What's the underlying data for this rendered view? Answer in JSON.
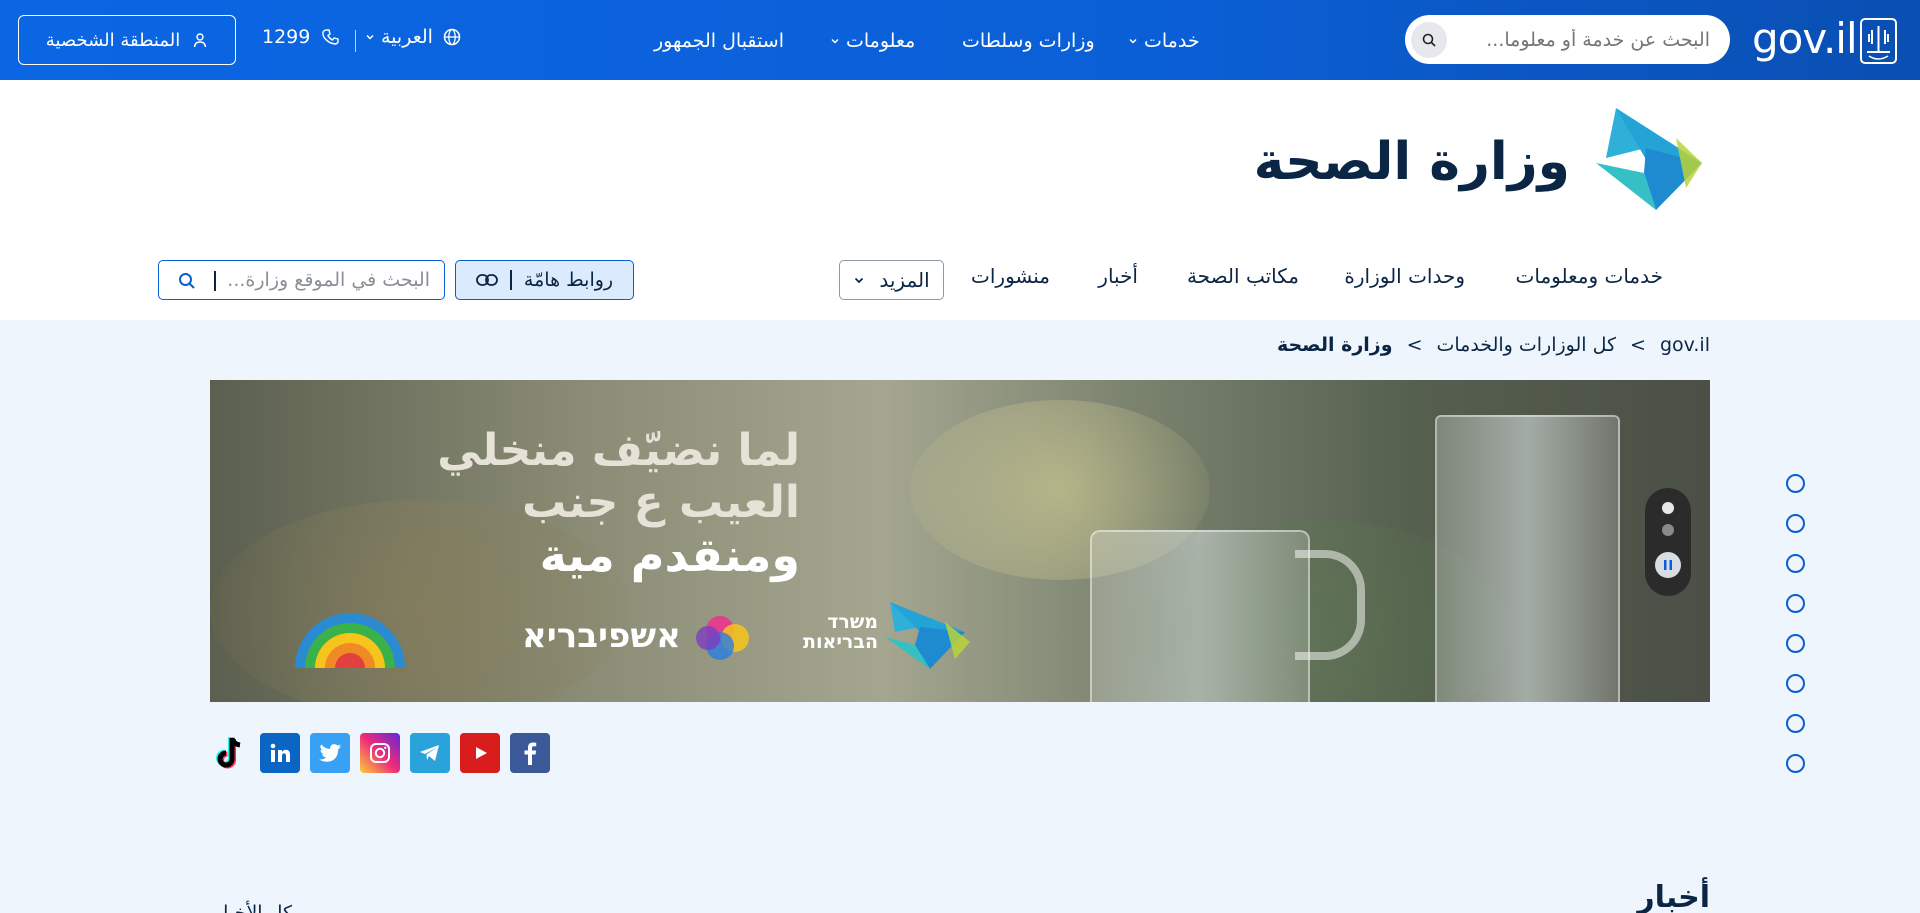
{
  "topbar": {
    "logo_text": "gov.il",
    "search_placeholder": "البحث عن خدمة أو معلوما...",
    "nav": [
      {
        "label": "خدمات"
      },
      {
        "label": "وزارات وسلطات"
      },
      {
        "label": "معلومات"
      },
      {
        "label": "استقبال الجمهور"
      }
    ],
    "language": "العربية",
    "phone": "1299",
    "personal_area": "المنطقة الشخصية"
  },
  "ministry": {
    "title": "وزارة الصحة",
    "nav": [
      {
        "label": "خدمات ومعلومات"
      },
      {
        "label": "وحدات الوزارة"
      },
      {
        "label": "مكاتب الصحة"
      },
      {
        "label": "أخبار"
      },
      {
        "label": "منشورات"
      }
    ],
    "more_label": "المزيد",
    "links_label": "روابط هامّة",
    "search_placeholder": "البحث في الموقع وزارة..."
  },
  "breadcrumb": {
    "items": [
      "gov.il",
      "كل الوزارات والخدمات"
    ],
    "current": "وزارة الصحة",
    "separator": ">"
  },
  "banner": {
    "line1": "لما نضيّف منخلي",
    "line2": "العيب ع جنب",
    "line3": "ومنقدم مية",
    "moh_logo_text": "משרד הבריאות",
    "partner_text": "אשפיבריא",
    "slides_total": 2,
    "active_slide": 1
  },
  "side_nav": {
    "count": 8
  },
  "social": [
    {
      "name": "facebook",
      "color": "#3b5998"
    },
    {
      "name": "youtube",
      "color": "#d91c1c"
    },
    {
      "name": "telegram",
      "color": "#2aa3dc"
    },
    {
      "name": "instagram",
      "color": "#d6249f"
    },
    {
      "name": "twitter",
      "color": "#38a1f3"
    },
    {
      "name": "linkedin",
      "color": "#0a66c2"
    },
    {
      "name": "tiktok",
      "color": "#000000"
    }
  ],
  "news": {
    "title": "أخبار",
    "all_link": "كل الأخبار"
  },
  "colors": {
    "topbar": "#0b66e4",
    "accent": "#0a5ed4",
    "page_bg": "#eef5fd",
    "text": "#0b2644"
  }
}
